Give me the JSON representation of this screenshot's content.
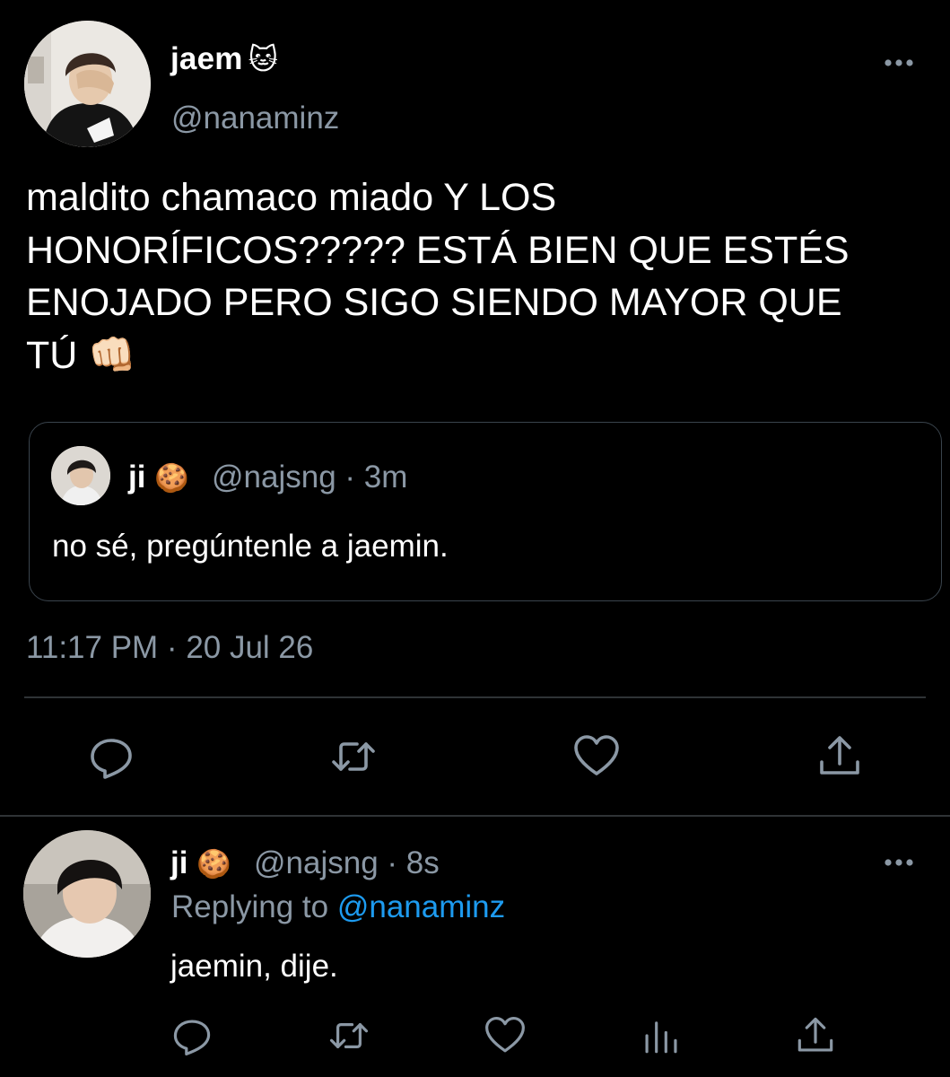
{
  "main_tweet": {
    "display_name": "jaem",
    "name_emoji": "🐱",
    "handle": "@nanaminz",
    "text_lines": [
      "maldito chamaco miado Y LOS",
      "HONORÍFICOS????? ESTÁ BIEN QUE ESTÉS",
      "ENOJADO PERO SIGO SIENDO MAYOR QUE",
      "TÚ 👊🏻"
    ],
    "timestamp": "11:17 PM · 20 Jul 26",
    "quoted_tweet": {
      "display_name": "ji",
      "name_emoji": "🍪",
      "handle_time": "@najsng · 3m",
      "text": "no sé, pregúntenle a jaemin."
    },
    "actions": [
      "reply-icon",
      "retweet-icon",
      "like-icon",
      "share-icon"
    ]
  },
  "reply_tweet": {
    "display_name": "ji",
    "name_emoji": "🍪",
    "handle_time": "@najsng · 8s",
    "replying_prefix": "Replying to",
    "replying_mention": "@nanaminz",
    "text": "jaemin, dije.",
    "actions": [
      "reply-icon",
      "retweet-icon",
      "like-icon",
      "analytics-icon",
      "share-icon"
    ]
  },
  "colors": {
    "background": "#000000",
    "text": "#ffffff",
    "secondary": "#8b98a5",
    "link": "#1d9bf0",
    "border": "#2f3336"
  }
}
